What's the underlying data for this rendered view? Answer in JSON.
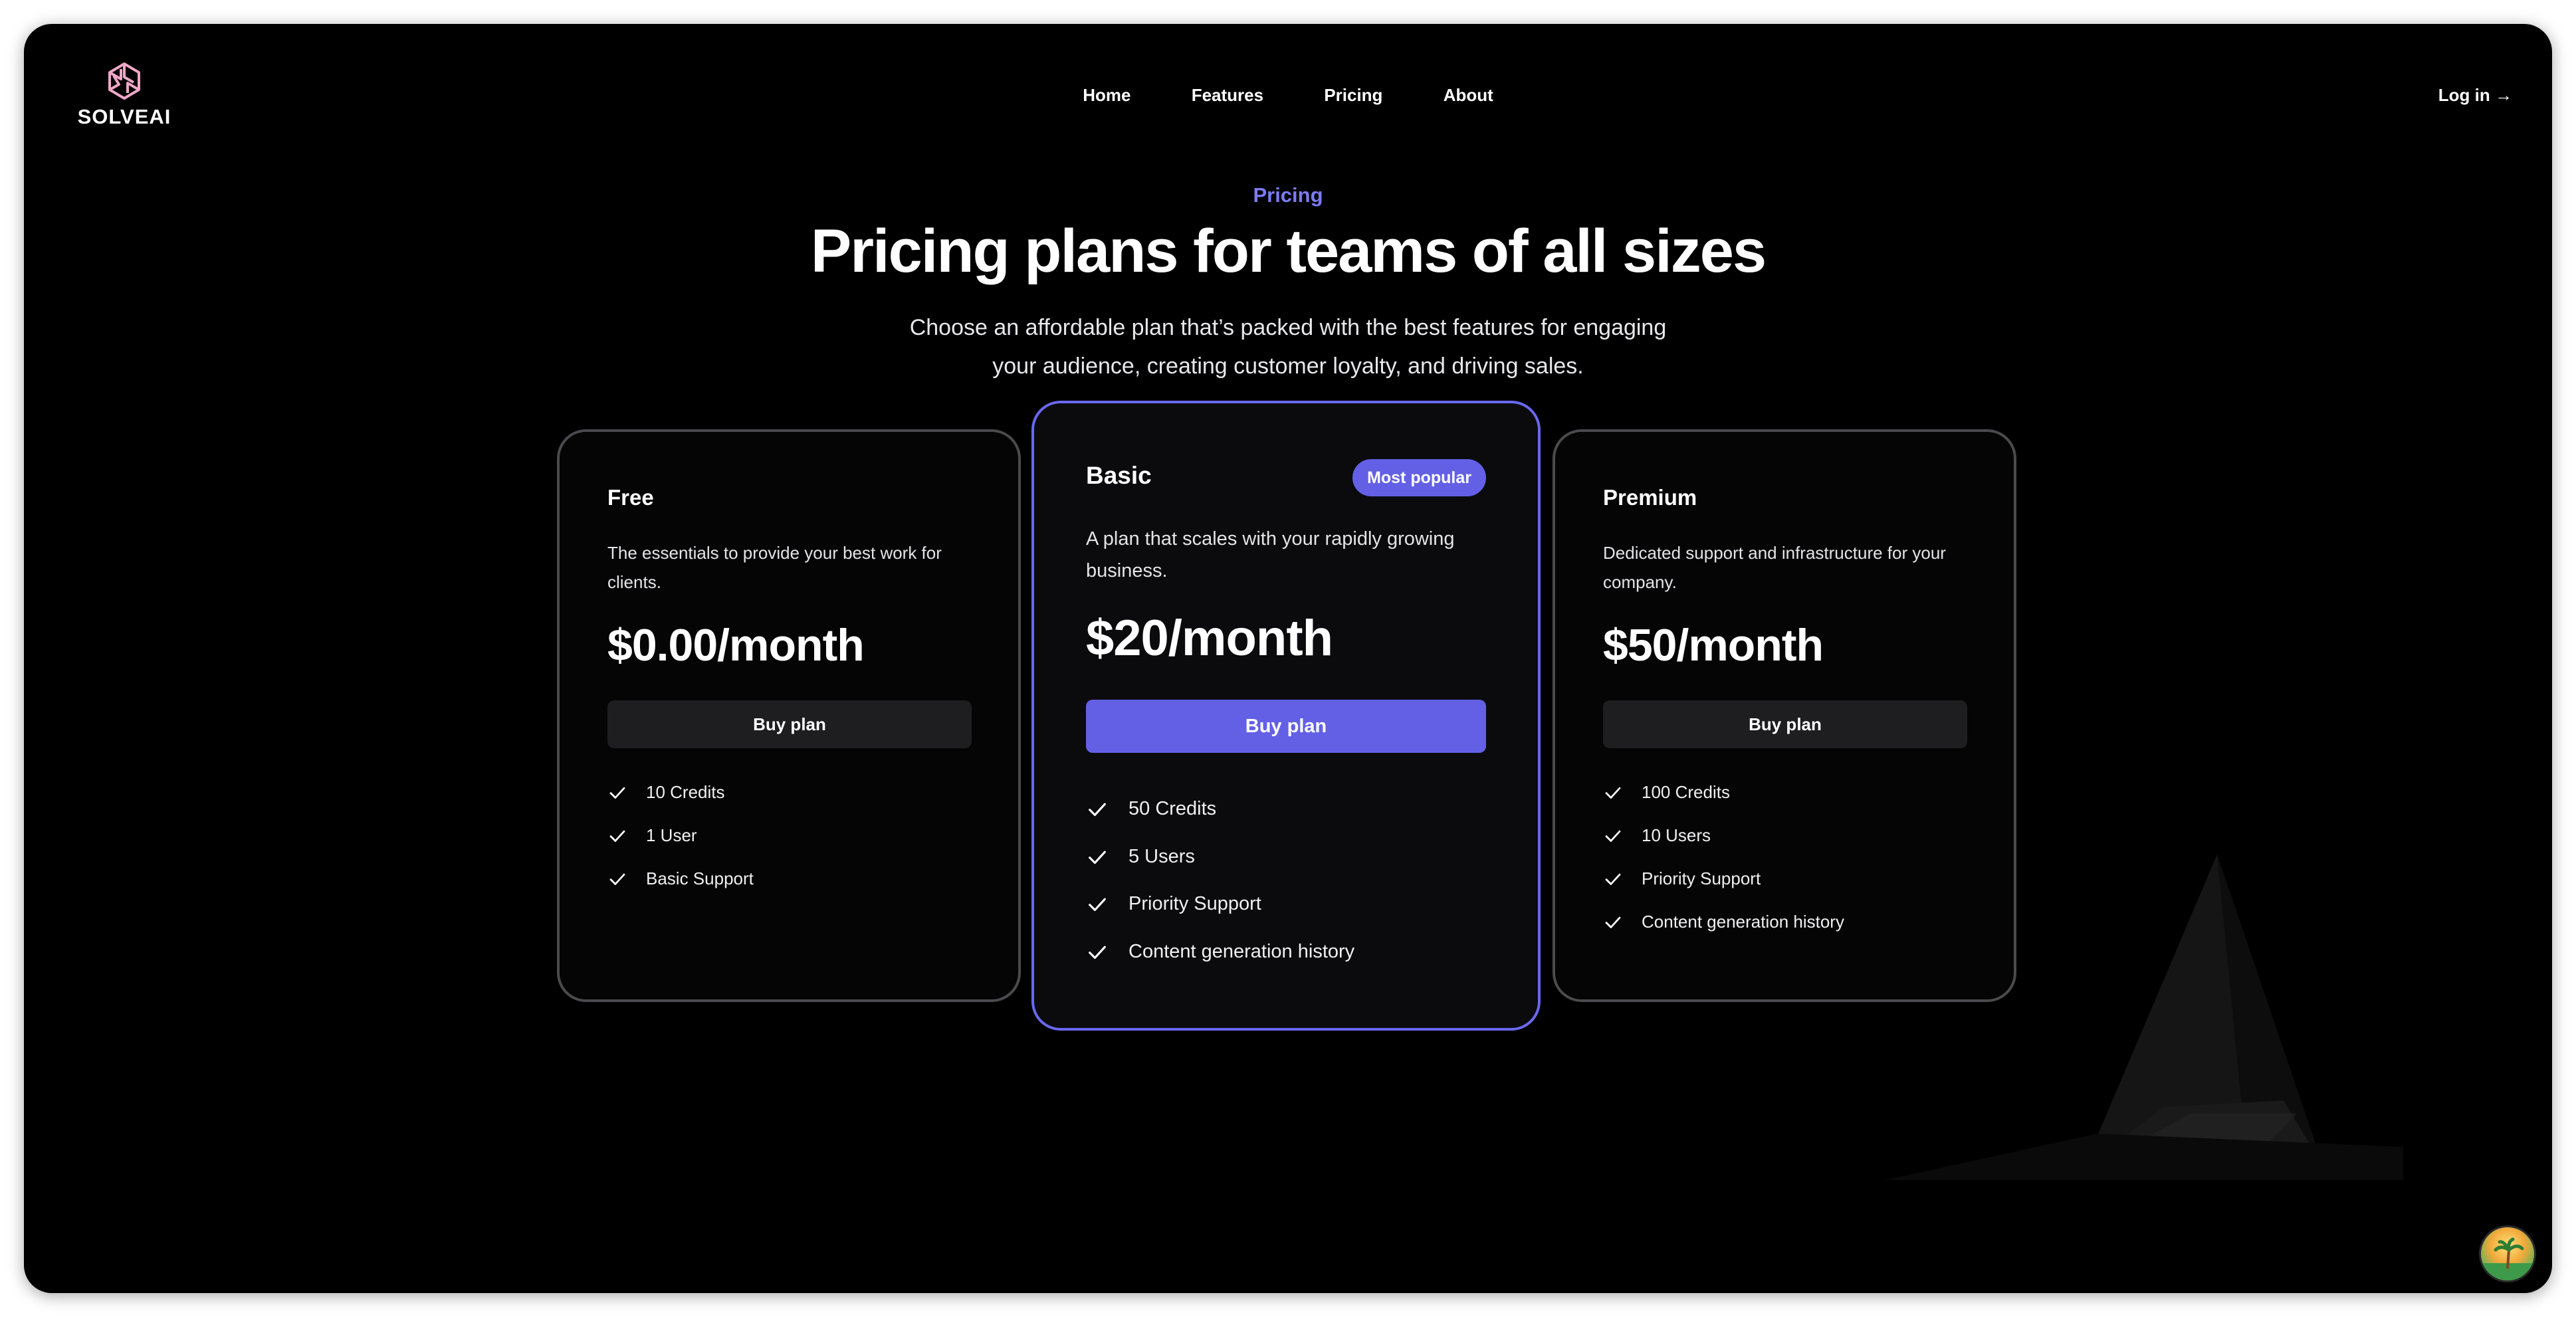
{
  "brand": {
    "name": "SOLVEAI",
    "logo_icon": "hexagon-knot-icon",
    "logo_color": "#f1a7c8"
  },
  "nav": {
    "items": [
      {
        "label": "Home"
      },
      {
        "label": "Features"
      },
      {
        "label": "Pricing"
      },
      {
        "label": "About"
      }
    ],
    "login_label": "Log in →"
  },
  "hero": {
    "eyebrow": "Pricing",
    "title": "Pricing plans for teams of all sizes",
    "subtitle": "Choose an affordable plan that’s packed with the best features for engaging your audience, creating customer loyalty, and driving sales."
  },
  "plans": [
    {
      "name": "Free",
      "description": "The essentials to provide your best work for clients.",
      "price": "$0.00/month",
      "button_label": "Buy plan",
      "features": [
        "10 Credits",
        "1 User",
        "Basic Support"
      ]
    },
    {
      "name": "Basic",
      "badge": "Most popular",
      "description": "A plan that scales with your rapidly growing business.",
      "price": "$20/month",
      "button_label": "Buy plan",
      "features": [
        "50 Credits",
        "5 Users",
        "Priority Support",
        "Content generation history"
      ]
    },
    {
      "name": "Premium",
      "description": "Dedicated support and infrastructure for your company.",
      "price": "$50/month",
      "button_label": "Buy plan",
      "features": [
        "100 Credits",
        "10 Users",
        "Priority Support",
        "Content generation history"
      ]
    }
  ],
  "colors": {
    "background": "#000000",
    "accent": "#6360e6",
    "eyebrow": "#7b7cf2",
    "card_border": "#4a4a4f"
  },
  "icons": {
    "feature": "check-icon",
    "help": "help-avatar-icon"
  }
}
